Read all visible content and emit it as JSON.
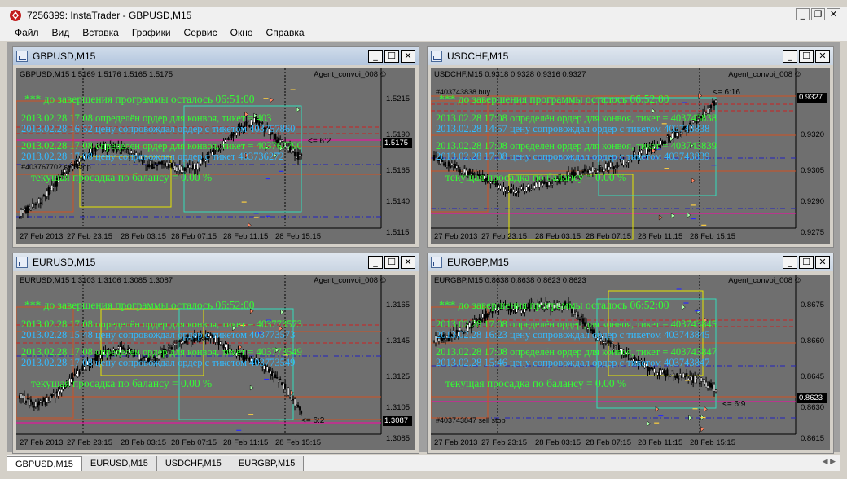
{
  "window": {
    "title": "7256399: InstaTrader - GBPUSD,M15"
  },
  "menu": [
    "Файл",
    "Вид",
    "Вставка",
    "Графики",
    "Сервис",
    "Окно",
    "Справка"
  ],
  "colors": {
    "plot_bg": "#6f6f6f",
    "green_text": "#33ff33",
    "cyan_text": "#33bbff",
    "yellow_box": "#e6e600",
    "teal_box": "#33ddbb",
    "orange_line": "#d05020",
    "blue_line": "#2020c0",
    "magenta": "#ff00aa"
  },
  "charts": [
    {
      "name": "GBPUSD,M15",
      "header": "GBPUSD,M15  1.5169 1.5176 1.5165 1.5175",
      "agent": "Agent_convoi_008",
      "price_labels": [
        "1.5215",
        "1.5190",
        "1.5165",
        "1.5140",
        "1.5115"
      ],
      "price_box": "1.5175",
      "time_labels": [
        "27 Feb 2013",
        "27 Feb 23:15",
        "28 Feb 03:15",
        "28 Feb 07:15",
        "28 Feb 11:15",
        "28 Feb 15:15"
      ],
      "countdown": "***  до завершения программы осталось  06:51:00",
      "lines": [
        "2013.02.28 17:08 определён ордер для конвоя, тикет = 403",
        "2013.02.28 16:52 цену сопровождал ордер с тикетом 403757860",
        "2013.02.28 17:08 определён ордер для конвоя, тикет = 403767790",
        "2013.02.28 17:08 цену сопровождал ордер с тикет 403736272"
      ],
      "drawdown": "текущая просадка по балансу =  0.00 %",
      "ticket_label": "#403767702 sell stop",
      "arrow_label": "<= 6:2"
    },
    {
      "name": "USDCHF,M15",
      "header": "USDCHF,M15  0.9318 0.9328 0.9316 0.9327",
      "agent": "Agent_convoi_008",
      "price_labels": [
        "0.9335",
        "0.9320",
        "0.9305",
        "0.9290",
        "0.9275"
      ],
      "price_box": "0.9327",
      "time_labels": [
        "27 Feb 2013",
        "27 Feb 23:15",
        "28 Feb 03:15",
        "28 Feb 07:15",
        "28 Feb 11:15",
        "28 Feb 15:15"
      ],
      "countdown": "***  до завершения программы осталось  06:52:00",
      "lines": [
        "2013.02.28 17:08 определён ордер для конвоя, тикет = 403743838",
        "2013.02.28 14:57 цену сопровождал ордер с тикетом 403743838",
        "2013.02.28 17:08 определён ордер для конвоя, тикет = 403743839",
        "2013.02.28 17:08 цену сопровождал ордер с тикетом 403743839"
      ],
      "drawdown": "текущая просадка по балансу =  0.00 %",
      "ticket_label": "#403743838 buy",
      "arrow_label": "<= 6:16"
    },
    {
      "name": "EURUSD,M15",
      "header": "EURUSD,M15  1.3103 1.3106 1.3085 1.3087",
      "agent": "Agent_convoi_008",
      "price_labels": [
        "1.3165",
        "1.3145",
        "1.3125",
        "1.3105",
        "1.3085"
      ],
      "price_box": "1.3087",
      "time_labels": [
        "27 Feb 2013",
        "27 Feb 23:15",
        "28 Feb 03:15",
        "28 Feb 07:15",
        "28 Feb 11:15",
        "28 Feb 15:15"
      ],
      "countdown": "***  до завершения программы осталось  06:52:00",
      "lines": [
        "2013.02.28 17:08 определён ордер для конвоя, тикет = 403773573",
        "2013.02.28 15:48 цену сопровождал ордер с тикетом 403773573",
        "2013.02.28 17:08 определён ордер для конвоя, тикет = 403773549",
        "2013.02.28 17:08 цену сопровождал ордер с тикетом 403773549"
      ],
      "drawdown": "текущая просадка по балансу =  0.00 %",
      "ticket_label": "",
      "arrow_label": "<= 6:2"
    },
    {
      "name": "EURGBP,M15",
      "header": "EURGBP,M15  0.8638 0.8638 0.8623 0.8623",
      "agent": "Agent_convoi_008",
      "price_labels": [
        "0.8675",
        "0.8660",
        "0.8645",
        "0.8630",
        "0.8615"
      ],
      "price_box": "0.8623",
      "time_labels": [
        "27 Feb 2013",
        "27 Feb 23:15",
        "28 Feb 03:15",
        "28 Feb 07:15",
        "28 Feb 11:15",
        "28 Feb 15:15"
      ],
      "countdown": "***  до завершения программы осталось  06:52:00",
      "lines": [
        "2013.02.28 17:08 определён ордер для конвоя, тикет = 403743845",
        "2013.02.28 16:23 цену сопровождал ордер с тикетом 403743845",
        "2013.02.28 17:08 определён ордер для конвоя, тикет = 403743847",
        "2013.02.28 15:46 цену сопровождал ордер с тикетом 403743847"
      ],
      "drawdown": "текущая просадка по балансу =  0.00 %",
      "ticket_label": "#403743847 sell stop",
      "arrow_label": "<= 6:9"
    }
  ],
  "tabs": [
    "GBPUSD,M15",
    "EURUSD,M15",
    "USDCHF,M15",
    "EURGBP,M15"
  ]
}
